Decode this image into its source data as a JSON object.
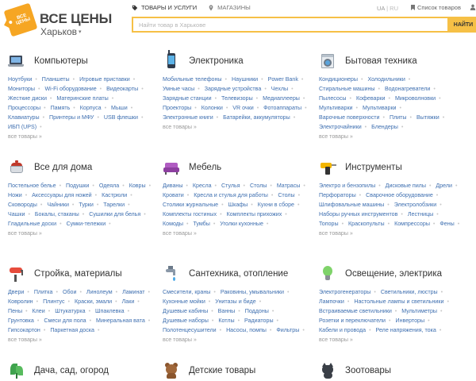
{
  "header": {
    "logo_tag": "ВСЕ ЦЕНЫ",
    "logo_text": "ВСЕ ЦЕНЫ",
    "city": "Харьков",
    "tabs": [
      {
        "label": "ТОВАРЫ И УСЛУГИ",
        "icon": "tag-icon",
        "active": true
      },
      {
        "label": "МАГАЗИНЫ",
        "icon": "map-pin-icon",
        "active": false
      }
    ],
    "lang_ua": "UA",
    "lang_divider": "|",
    "lang_ru": "RU",
    "wishlist": "Список товаров",
    "search_placeholder": "Найти товар в Харькове",
    "search_button": "НАЙТИ"
  },
  "colors": {
    "accent": "#f6c046",
    "link": "#3e6fb0",
    "muted": "#9a9a9a"
  },
  "categories": [
    {
      "title": "Компьютеры",
      "icon": "laptop-icon",
      "links": [
        "Ноутбуки",
        "Планшеты",
        "Игровые приставки",
        "Мониторы",
        "Wi-Fi оборудование",
        "Видеокарты",
        "Жесткие диски",
        "Материнские платы",
        "Процессоры",
        "Память",
        "Корпуса",
        "Мыши",
        "Клавиатуры",
        "Принтеры и МФУ",
        "USB флешки",
        "ИБП (UPS)"
      ],
      "all": "все товары »"
    },
    {
      "title": "Электроника",
      "icon": "phone-icon",
      "links": [
        "Мобильные телефоны",
        "Наушники",
        "Power Bank",
        "Умные часы",
        "Зарядные устройства",
        "Чехлы",
        "Зарядные станции",
        "Телевизоры",
        "Медиаплееры",
        "Проекторы",
        "Колонки",
        "VR очки",
        "Фотоаппараты",
        "Электронные книги",
        "Батарейки, аккумуляторы"
      ],
      "all": "все товары »"
    },
    {
      "title": "Бытовая техника",
      "icon": "washing-machine-icon",
      "links": [
        "Кондиционеры",
        "Холодильники",
        "Стиральные машины",
        "Водонагреватели",
        "Пылесосы",
        "Кофеварки",
        "Микроволновки",
        "Мультиварки",
        "Мультиварки",
        "Варочные поверхности",
        "Плиты",
        "Вытяжки",
        "Электрочайники",
        "Блендеры"
      ],
      "all": "все товары »"
    },
    {
      "title": "Все для дома",
      "icon": "pot-icon",
      "links": [
        "Постельное белье",
        "Подушки",
        "Одеяла",
        "Ковры",
        "Ножи",
        "Аксессуары для ножей",
        "Кастрюли",
        "Сковороды",
        "Чайники",
        "Турки",
        "Тарелки",
        "Чашки",
        "Бокалы, стаканы",
        "Сушилки для белья",
        "Гладильные доски",
        "Сумки-тележки"
      ],
      "all": "все товары »"
    },
    {
      "title": "Мебель",
      "icon": "sofa-icon",
      "links": [
        "Диваны",
        "Кресла",
        "Стулья",
        "Столы",
        "Матрасы",
        "Кровати",
        "Кресла и стулья для работы",
        "Столы",
        "Столики журнальные",
        "Шкафы",
        "Кухни в сборе",
        "Комплекты гостиных",
        "Комплекты прихожих",
        "Комоды",
        "Тумбы",
        "Уголки кухонные"
      ],
      "all": "все товары »"
    },
    {
      "title": "Инструменты",
      "icon": "drill-icon",
      "links": [
        "Электро и бензопилы",
        "Дисковые пилы",
        "Дрели",
        "Перфораторы",
        "Сварочное оборудование",
        "Шлифовальные машины",
        "Электролобзики",
        "Наборы ручных инструментов",
        "Лестницы",
        "Топоры",
        "Краскопульты",
        "Компрессоры",
        "Фены"
      ],
      "all": "все товары »"
    },
    {
      "title": "Стройка, материалы",
      "icon": "paint-roller-icon",
      "links": [
        "Двери",
        "Плитка",
        "Обои",
        "Линолеум",
        "Ламинат",
        "Ковролин",
        "Плинтус",
        "Краски, эмали",
        "Лаки",
        "Пены",
        "Клеи",
        "Штукатурка",
        "Шпаклевка",
        "Грунтовка",
        "Смеси для пола",
        "Минеральная вата",
        "Гипсокартон",
        "Паркетная доска"
      ],
      "all": "все товары »"
    },
    {
      "title": "Сантехника, отопление",
      "icon": "faucet-icon",
      "links": [
        "Смесители, краны",
        "Раковины, умывальники",
        "Кухонные мойки",
        "Унитазы и биде",
        "Душевые кабины",
        "Ванны",
        "Поддоны",
        "Душевые наборы",
        "Котлы",
        "Радиаторы",
        "Полотенцесушители",
        "Насосы, помпы",
        "Фильтры"
      ],
      "all": "все товары »"
    },
    {
      "title": "Освещение, электрика",
      "icon": "light-bulb-icon",
      "links": [
        "Электрогенераторы",
        "Светильники, люстры",
        "Лампочки",
        "Настольные лампы и светильники",
        "Встраиваемые светильники",
        "Мультиметры",
        "Розетки и переключатели",
        "Инверторы",
        "Кабели и провода",
        "Реле напряжения, тока"
      ],
      "all": "все товары »"
    },
    {
      "title": "Дача, сад, огород",
      "icon": "garden-plant-icon",
      "links": [],
      "all": ""
    },
    {
      "title": "Детские товары",
      "icon": "teddy-bear-icon",
      "links": [],
      "all": ""
    },
    {
      "title": "Зоотовары",
      "icon": "cat-icon",
      "links": [],
      "all": ""
    }
  ]
}
